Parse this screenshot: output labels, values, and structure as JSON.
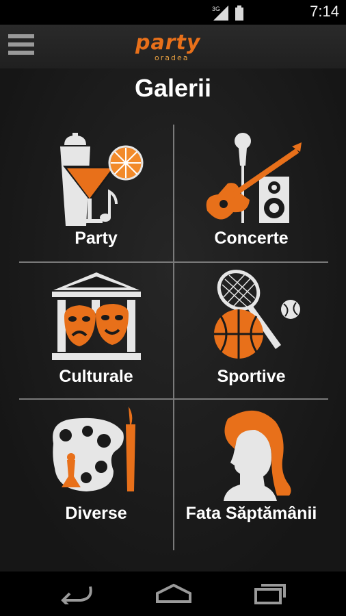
{
  "status_bar": {
    "network": "3G",
    "time": "7:14"
  },
  "action_bar": {
    "menu_icon": "hamburger-menu-icon",
    "logo_text": "party",
    "logo_subtext": "oradea"
  },
  "page": {
    "title": "Galerii"
  },
  "categories": [
    {
      "label": "Party",
      "icon": "cocktail-icon"
    },
    {
      "label": "Concerte",
      "icon": "guitar-microphone-icon"
    },
    {
      "label": "Culturale",
      "icon": "theater-masks-icon"
    },
    {
      "label": "Sportive",
      "icon": "sports-balls-icon"
    },
    {
      "label": "Diverse",
      "icon": "palette-brush-icon"
    },
    {
      "label": "Fata Săptămânii",
      "icon": "woman-silhouette-icon"
    }
  ],
  "colors": {
    "accent": "#e8701a",
    "icon_light": "#e6e6e6",
    "divider": "#7a7a7a"
  },
  "nav_bar": {
    "back_icon": "back-icon",
    "home_icon": "home-icon",
    "recents_icon": "recents-icon"
  }
}
